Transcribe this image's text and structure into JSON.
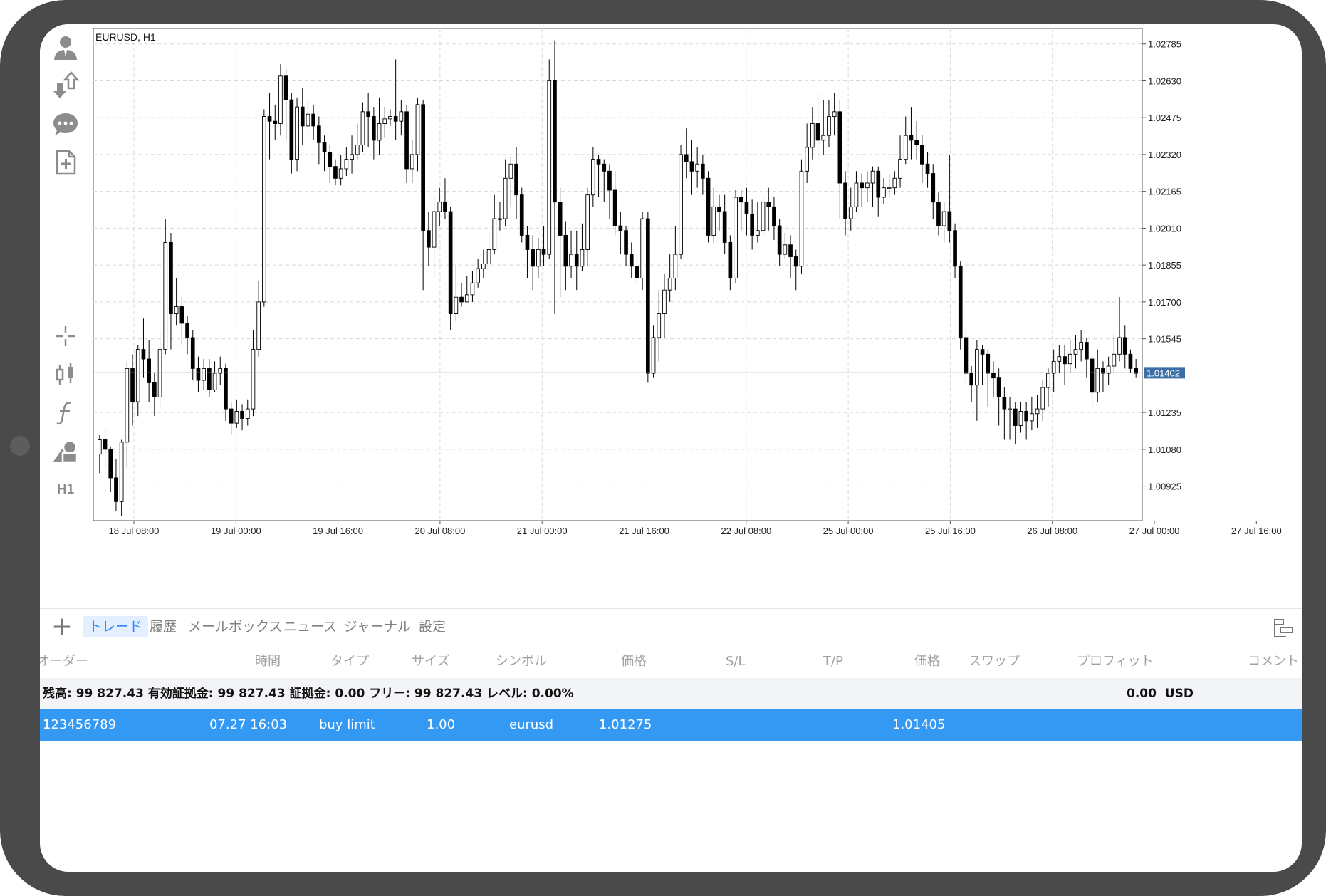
{
  "chart": {
    "symbol_label": "EURUSD, H1",
    "price_ticks": [
      "1.02785",
      "1.02630",
      "1.02475",
      "1.02320",
      "1.02165",
      "1.02010",
      "1.01855",
      "1.01700",
      "1.01545",
      "1.01402",
      "1.01235",
      "1.01080",
      "1.00925"
    ],
    "current_price": "1.01402",
    "time_ticks": [
      "18 Jul 08:00",
      "19 Jul 00:00",
      "19 Jul 16:00",
      "20 Jul 08:00",
      "21 Jul 00:00",
      "21 Jul 16:00",
      "22 Jul 08:00",
      "25 Jul 00:00",
      "25 Jul 16:00",
      "26 Jul 08:00",
      "27 Jul 00:00",
      "27 Jul 16:00"
    ],
    "colors": {
      "bull": "#ffffff",
      "bear": "#000000",
      "grid": "#d8d8d8",
      "price_line": "#8aa4c4",
      "price_tag": "#3b6ea5"
    }
  },
  "chart_data": {
    "type": "candlestick",
    "title": "EURUSD, H1",
    "ylim": [
      1.0078,
      1.0285
    ],
    "candles": [
      [
        1.0106,
        1.0112,
        1.0114,
        1.0098
      ],
      [
        1.0112,
        1.0108,
        1.0117,
        1.01
      ],
      [
        1.0108,
        1.0096,
        1.0109,
        1.009
      ],
      [
        1.0096,
        1.0086,
        1.0104,
        1.0082
      ],
      [
        1.0086,
        1.0111,
        1.0112,
        1.008
      ],
      [
        1.0111,
        1.0142,
        1.0145,
        1.01
      ],
      [
        1.0142,
        1.0128,
        1.0148,
        1.0118
      ],
      [
        1.0128,
        1.015,
        1.0152,
        1.0122
      ],
      [
        1.015,
        1.0146,
        1.0163,
        1.0138
      ],
      [
        1.0146,
        1.0136,
        1.0154,
        1.0128
      ],
      [
        1.0136,
        1.013,
        1.014,
        1.0122
      ],
      [
        1.013,
        1.015,
        1.0158,
        1.0125
      ],
      [
        1.015,
        1.0195,
        1.0205,
        1.0148
      ],
      [
        1.0195,
        1.0165,
        1.0199,
        1.015
      ],
      [
        1.0165,
        1.0168,
        1.018,
        1.016
      ],
      [
        1.0168,
        1.0161,
        1.0172,
        1.0152
      ],
      [
        1.0161,
        1.0155,
        1.0164,
        1.0148
      ],
      [
        1.0155,
        1.0142,
        1.0158,
        1.0137
      ],
      [
        1.0142,
        1.0137,
        1.0147,
        1.0132
      ],
      [
        1.0137,
        1.0142,
        1.0146,
        1.0133
      ],
      [
        1.0142,
        1.0133,
        1.0146,
        1.013
      ],
      [
        1.0133,
        1.014,
        1.0145,
        1.0132
      ],
      [
        1.014,
        1.0142,
        1.0147,
        1.0135
      ],
      [
        1.0142,
        1.0125,
        1.0144,
        1.012
      ],
      [
        1.0125,
        1.0119,
        1.0128,
        1.0114
      ],
      [
        1.0119,
        1.0124,
        1.0129,
        1.0117
      ],
      [
        1.0124,
        1.0121,
        1.0127,
        1.0116
      ],
      [
        1.0121,
        1.0125,
        1.0129,
        1.0118
      ],
      [
        1.0125,
        1.015,
        1.0158,
        1.0122
      ],
      [
        1.015,
        1.017,
        1.0179,
        1.0147
      ],
      [
        1.017,
        1.0248,
        1.0251,
        1.0168
      ],
      [
        1.0248,
        1.0246,
        1.0258,
        1.023
      ],
      [
        1.0246,
        1.0245,
        1.0253,
        1.0238
      ],
      [
        1.0245,
        1.0265,
        1.027,
        1.024
      ],
      [
        1.0265,
        1.0255,
        1.0268,
        1.0238
      ],
      [
        1.0255,
        1.023,
        1.0258,
        1.0224
      ],
      [
        1.023,
        1.0252,
        1.0256,
        1.0225
      ],
      [
        1.0252,
        1.0244,
        1.026,
        1.0236
      ],
      [
        1.0244,
        1.0249,
        1.0255,
        1.0242
      ],
      [
        1.0249,
        1.0244,
        1.0253,
        1.0238
      ],
      [
        1.0244,
        1.0237,
        1.0248,
        1.0228
      ],
      [
        1.0237,
        1.0233,
        1.024,
        1.0225
      ],
      [
        1.0233,
        1.0227,
        1.0236,
        1.022
      ],
      [
        1.0227,
        1.0222,
        1.023,
        1.0219
      ],
      [
        1.0222,
        1.0226,
        1.0232,
        1.0219
      ],
      [
        1.0226,
        1.023,
        1.0235,
        1.0223
      ],
      [
        1.023,
        1.0232,
        1.024,
        1.0224
      ],
      [
        1.0232,
        1.0236,
        1.0245,
        1.023
      ],
      [
        1.0236,
        1.025,
        1.0254,
        1.0233
      ],
      [
        1.025,
        1.0248,
        1.0258,
        1.0235
      ],
      [
        1.0248,
        1.0238,
        1.0252,
        1.023
      ],
      [
        1.0238,
        1.0245,
        1.0256,
        1.0232
      ],
      [
        1.0245,
        1.0247,
        1.0252,
        1.0239
      ],
      [
        1.0247,
        1.0248,
        1.0251,
        1.0244
      ],
      [
        1.0248,
        1.0246,
        1.0272,
        1.0238
      ],
      [
        1.0246,
        1.025,
        1.0255,
        1.024
      ],
      [
        1.025,
        1.0226,
        1.0253,
        1.022
      ],
      [
        1.0226,
        1.0232,
        1.0238,
        1.022
      ],
      [
        1.0232,
        1.0253,
        1.0256,
        1.0225
      ],
      [
        1.0253,
        1.02,
        1.0255,
        1.0175
      ],
      [
        1.02,
        1.0193,
        1.0208,
        1.0185
      ],
      [
        1.0193,
        1.0208,
        1.0215,
        1.018
      ],
      [
        1.0208,
        1.0212,
        1.0218,
        1.0202
      ],
      [
        1.0212,
        1.0208,
        1.0222,
        1.0205
      ],
      [
        1.0208,
        1.0165,
        1.021,
        1.0158
      ],
      [
        1.0165,
        1.0172,
        1.0185,
        1.0162
      ],
      [
        1.0172,
        1.017,
        1.0178,
        1.0168
      ],
      [
        1.017,
        1.0173,
        1.0181,
        1.017
      ],
      [
        1.0173,
        1.0178,
        1.0183,
        1.017
      ],
      [
        1.0178,
        1.0184,
        1.0188,
        1.0176
      ],
      [
        1.0184,
        1.0186,
        1.0192,
        1.018
      ],
      [
        1.0186,
        1.0192,
        1.02,
        1.0183
      ],
      [
        1.0192,
        1.0205,
        1.0215,
        1.019
      ],
      [
        1.0205,
        1.0205,
        1.0212,
        1.02
      ],
      [
        1.0205,
        1.0222,
        1.023,
        1.0202
      ],
      [
        1.0222,
        1.0228,
        1.0231,
        1.021
      ],
      [
        1.0228,
        1.0215,
        1.0235,
        1.0205
      ],
      [
        1.0215,
        1.0198,
        1.0218,
        1.0195
      ],
      [
        1.0198,
        1.0192,
        1.0202,
        1.018
      ],
      [
        1.0192,
        1.0185,
        1.0198,
        1.0175
      ],
      [
        1.0185,
        1.0192,
        1.0197,
        1.018
      ],
      [
        1.0192,
        1.019,
        1.0202,
        1.0185
      ],
      [
        1.019,
        1.0263,
        1.0272,
        1.0188
      ],
      [
        1.0263,
        1.0212,
        1.028,
        1.0165
      ],
      [
        1.0212,
        1.0198,
        1.0218,
        1.0172
      ],
      [
        1.0198,
        1.0185,
        1.0204,
        1.0175
      ],
      [
        1.0185,
        1.019,
        1.02,
        1.018
      ],
      [
        1.019,
        1.0185,
        1.02,
        1.0175
      ],
      [
        1.0185,
        1.0192,
        1.0203,
        1.0183
      ],
      [
        1.0192,
        1.0215,
        1.0218,
        1.0185
      ],
      [
        1.0215,
        1.023,
        1.0235,
        1.021
      ],
      [
        1.023,
        1.0228,
        1.0232,
        1.0214
      ],
      [
        1.0228,
        1.0225,
        1.023,
        1.0212
      ],
      [
        1.0225,
        1.0217,
        1.0228,
        1.0205
      ],
      [
        1.0217,
        1.0202,
        1.0225,
        1.0198
      ],
      [
        1.0202,
        1.02,
        1.0208,
        1.019
      ],
      [
        1.02,
        1.019,
        1.0202,
        1.0185
      ],
      [
        1.019,
        1.0185,
        1.0195,
        1.018
      ],
      [
        1.0185,
        1.018,
        1.019,
        1.0178
      ],
      [
        1.018,
        1.0205,
        1.0208,
        1.0175
      ],
      [
        1.0205,
        1.014,
        1.0208,
        1.0136
      ],
      [
        1.014,
        1.0155,
        1.016,
        1.0138
      ],
      [
        1.0155,
        1.0165,
        1.0175,
        1.0145
      ],
      [
        1.0165,
        1.0175,
        1.0182,
        1.0155
      ],
      [
        1.0175,
        1.018,
        1.019,
        1.017
      ],
      [
        1.018,
        1.019,
        1.0202,
        1.0175
      ],
      [
        1.019,
        1.0232,
        1.0236,
        1.0188
      ],
      [
        1.0232,
        1.0229,
        1.0243,
        1.0222
      ],
      [
        1.0229,
        1.0225,
        1.0238,
        1.0215
      ],
      [
        1.0225,
        1.0228,
        1.0235,
        1.0218
      ],
      [
        1.0228,
        1.0222,
        1.0232,
        1.0215
      ],
      [
        1.0222,
        1.0198,
        1.0225,
        1.0195
      ],
      [
        1.0198,
        1.021,
        1.0218,
        1.0195
      ],
      [
        1.021,
        1.0208,
        1.0215,
        1.02
      ],
      [
        1.0208,
        1.0195,
        1.0215,
        1.019
      ],
      [
        1.0195,
        1.018,
        1.0198,
        1.0175
      ],
      [
        1.018,
        1.0214,
        1.0217,
        1.0178
      ],
      [
        1.0214,
        1.0212,
        1.0217,
        1.02
      ],
      [
        1.0212,
        1.0207,
        1.0218,
        1.0198
      ],
      [
        1.0207,
        1.0198,
        1.0213,
        1.0192
      ],
      [
        1.0198,
        1.02,
        1.0212,
        1.0195
      ],
      [
        1.02,
        1.0212,
        1.0215,
        1.0198
      ],
      [
        1.0212,
        1.021,
        1.0218,
        1.02
      ],
      [
        1.021,
        1.0202,
        1.0214,
        1.0196
      ],
      [
        1.0202,
        1.019,
        1.0205,
        1.0185
      ],
      [
        1.019,
        1.0194,
        1.0199,
        1.0188
      ],
      [
        1.0194,
        1.0189,
        1.0198,
        1.018
      ],
      [
        1.0189,
        1.0185,
        1.0192,
        1.0175
      ],
      [
        1.0185,
        1.0225,
        1.023,
        1.0182
      ],
      [
        1.0225,
        1.0235,
        1.0245,
        1.022
      ],
      [
        1.0235,
        1.0245,
        1.0252,
        1.023
      ],
      [
        1.0245,
        1.0238,
        1.0258,
        1.023
      ],
      [
        1.0238,
        1.024,
        1.0255,
        1.0232
      ],
      [
        1.024,
        1.0248,
        1.0255,
        1.0235
      ],
      [
        1.0248,
        1.025,
        1.0258,
        1.024
      ],
      [
        1.025,
        1.022,
        1.0255,
        1.0205
      ],
      [
        1.022,
        1.0205,
        1.0225,
        1.0198
      ],
      [
        1.0205,
        1.021,
        1.0218,
        1.02
      ],
      [
        1.021,
        1.022,
        1.0225,
        1.0208
      ],
      [
        1.022,
        1.0218,
        1.0224,
        1.021
      ],
      [
        1.0218,
        1.022,
        1.0225,
        1.0212
      ],
      [
        1.022,
        1.0225,
        1.0227,
        1.021
      ],
      [
        1.0225,
        1.0214,
        1.0227,
        1.0206
      ],
      [
        1.0214,
        1.0218,
        1.0222,
        1.0211
      ],
      [
        1.0218,
        1.0218,
        1.0224,
        1.0214
      ],
      [
        1.0218,
        1.0222,
        1.0225,
        1.0215
      ],
      [
        1.0222,
        1.023,
        1.024,
        1.0218
      ],
      [
        1.023,
        1.024,
        1.0248,
        1.0228
      ],
      [
        1.024,
        1.0238,
        1.0252,
        1.023
      ],
      [
        1.0238,
        1.0236,
        1.0246,
        1.023
      ],
      [
        1.0236,
        1.0228,
        1.024,
        1.022
      ],
      [
        1.0228,
        1.0224,
        1.0233,
        1.0218
      ],
      [
        1.0224,
        1.0212,
        1.0228,
        1.0205
      ],
      [
        1.0212,
        1.0202,
        1.0216,
        1.0198
      ],
      [
        1.0202,
        1.0208,
        1.0212,
        1.0195
      ],
      [
        1.0208,
        1.02,
        1.0232,
        1.0195
      ],
      [
        1.02,
        1.0185,
        1.0203,
        1.018
      ],
      [
        1.0185,
        1.0155,
        1.0187,
        1.015
      ],
      [
        1.0155,
        1.014,
        1.016,
        1.0136
      ],
      [
        1.014,
        1.0135,
        1.0143,
        1.0128
      ],
      [
        1.0135,
        1.015,
        1.0154,
        1.012
      ],
      [
        1.015,
        1.0148,
        1.0152,
        1.0135
      ],
      [
        1.0148,
        1.014,
        1.015,
        1.0126
      ],
      [
        1.014,
        1.0138,
        1.0145,
        1.013
      ],
      [
        1.0138,
        1.013,
        1.0142,
        1.0118
      ],
      [
        1.013,
        1.0125,
        1.0134,
        1.0112
      ],
      [
        1.0125,
        1.0125,
        1.013,
        1.0112
      ],
      [
        1.0125,
        1.0118,
        1.0128,
        1.011
      ],
      [
        1.0118,
        1.0124,
        1.0128,
        1.0115
      ],
      [
        1.0124,
        1.012,
        1.0128,
        1.0112
      ],
      [
        1.012,
        1.0123,
        1.013,
        1.0116
      ],
      [
        1.0123,
        1.0125,
        1.0131,
        1.0117
      ],
      [
        1.0125,
        1.0134,
        1.0137,
        1.012
      ],
      [
        1.0134,
        1.014,
        1.0142,
        1.0126
      ],
      [
        1.014,
        1.0145,
        1.015,
        1.0132
      ],
      [
        1.0145,
        1.0147,
        1.0152,
        1.014
      ],
      [
        1.0147,
        1.0144,
        1.0152,
        1.0135
      ],
      [
        1.0144,
        1.0148,
        1.0154,
        1.014
      ],
      [
        1.0148,
        1.015,
        1.0156,
        1.0142
      ],
      [
        1.015,
        1.0153,
        1.0158,
        1.0145
      ],
      [
        1.0153,
        1.0146,
        1.0155,
        1.0138
      ],
      [
        1.0146,
        1.0132,
        1.0148,
        1.0126
      ],
      [
        1.0132,
        1.0142,
        1.015,
        1.0128
      ],
      [
        1.0142,
        1.014,
        1.0145,
        1.0132
      ],
      [
        1.014,
        1.0143,
        1.0147,
        1.0135
      ],
      [
        1.0143,
        1.0148,
        1.0156,
        1.014
      ],
      [
        1.0148,
        1.0155,
        1.0172,
        1.0145
      ],
      [
        1.0155,
        1.0148,
        1.016,
        1.0142
      ],
      [
        1.0148,
        1.0142,
        1.015,
        1.014
      ],
      [
        1.0142,
        1.014,
        1.0146,
        1.0138
      ]
    ]
  },
  "tabs": [
    {
      "label": "トレード",
      "active": true
    },
    {
      "label": "履歴",
      "active": false
    },
    {
      "label": "メールボックス",
      "active": false
    },
    {
      "label": "ニュース",
      "active": false
    },
    {
      "label": "ジャーナル",
      "active": false
    },
    {
      "label": "設定",
      "active": false
    }
  ],
  "table": {
    "columns": [
      "オーダー",
      "時間",
      "タイプ",
      "サイズ",
      "シンボル",
      "価格",
      "S/L",
      "T/P",
      "価格",
      "スワップ",
      "プロフィット",
      "コメント"
    ],
    "balance_text": "残高: 99 827.43 有効証拠金: 99 827.43 証拠金: 0.00 フリー: 99 827.43 レベル: 0.00%",
    "balance_profit": "0.00",
    "balance_currency": "USD",
    "rows": [
      {
        "order": "123456789",
        "time": "07.27 16:03",
        "type": "buy limit",
        "size": "1.00",
        "symbol": "eurusd",
        "price": "1.01275",
        "sl": "",
        "tp": "",
        "current": "1.01405",
        "swap": "",
        "profit": "",
        "comment": ""
      }
    ]
  },
  "toolbar_icons": [
    "account-icon",
    "trade-arrows-icon",
    "chat-icon",
    "new-document-icon",
    "crosshair-icon",
    "candlestick-icon",
    "function-icon",
    "objects-icon"
  ],
  "timeframe_label": "H1",
  "colors": {
    "accent": "#2f86f6",
    "row_selected": "#3399f3",
    "tab_active_bg": "#e3efff",
    "bezel": "#4a4a4a"
  }
}
